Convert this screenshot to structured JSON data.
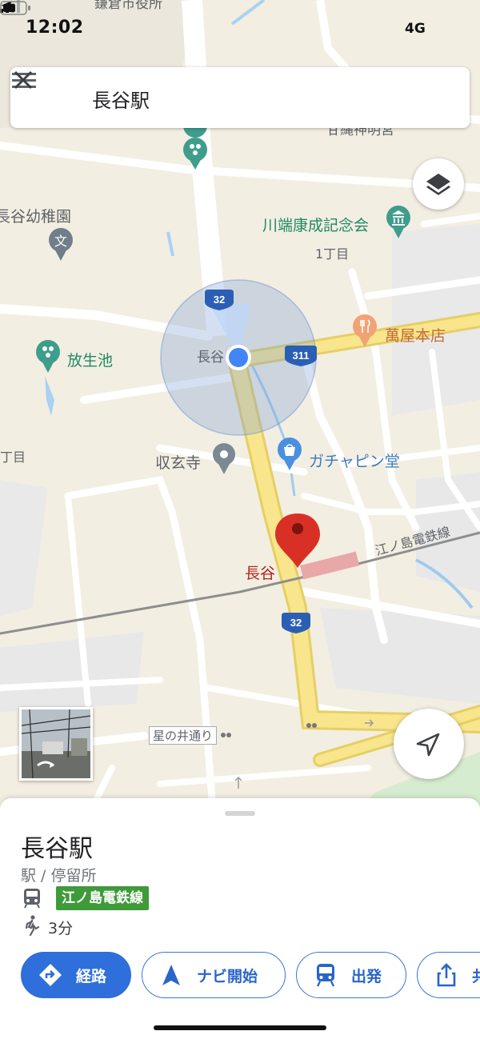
{
  "status_bar": {
    "time": "12:02",
    "network": "4G"
  },
  "search": {
    "query": "長谷駅"
  },
  "map": {
    "labels": {
      "kindergarten": "長谷幼稚園",
      "kawabata_museum": "川端康成記念会",
      "chome1": "1丁目",
      "manya": "萬屋本店",
      "hojoike": "放生池",
      "hase_partial": "長谷",
      "chome_left": "丁目",
      "shugenji": "収玄寺",
      "gachapin": "ガチャピン堂",
      "enoden_line": "江ノ島電鉄線",
      "hase_station": "長谷",
      "hoshinoi": "星の井通り",
      "top_partial_a": "鎌倉市役所",
      "top_partial_b": "甘縄神明宮"
    },
    "route_shields": [
      "32",
      "311",
      "32"
    ],
    "icons": [
      "menu-icon",
      "close-icon",
      "layers-icon",
      "my-location-icon",
      "place-pin-icon",
      "restaurant-icon",
      "museum-icon",
      "school-icon",
      "park-icon",
      "shop-icon"
    ]
  },
  "sheet": {
    "title": "長谷駅",
    "category": "駅 / 停留所",
    "line_name": "江ノ島電鉄線",
    "line_color": "#3f9a39",
    "walk_time": "3分",
    "buttons": {
      "directions": "経路",
      "start_nav": "ナビ開始",
      "depart": "出発",
      "share": "共有"
    }
  },
  "colors": {
    "accent": "#2e6fdb",
    "pin": "#d93025",
    "road_major": "#f8e58c"
  }
}
